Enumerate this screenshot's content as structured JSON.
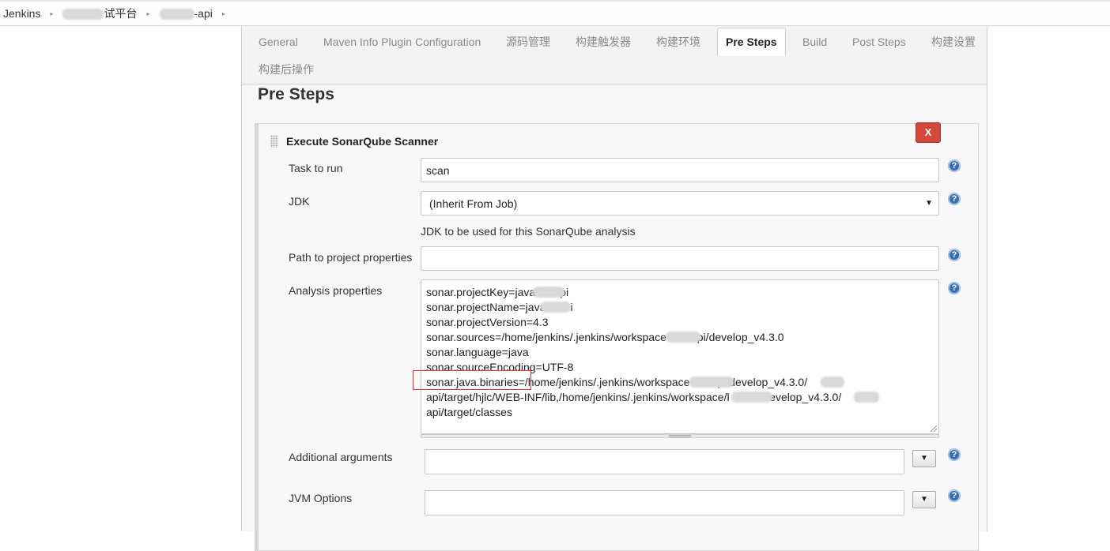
{
  "breadcrumb": {
    "items": [
      {
        "label": "Jenkins"
      },
      {
        "label": "试平台"
      },
      {
        "label": "-api"
      }
    ],
    "separator": "▸"
  },
  "tabs": [
    {
      "label": "General"
    },
    {
      "label": "Maven Info Plugin Configuration"
    },
    {
      "label": "源码管理"
    },
    {
      "label": "构建触发器"
    },
    {
      "label": "构建环境"
    },
    {
      "label": "Pre Steps",
      "active": true
    },
    {
      "label": "Build"
    },
    {
      "label": "Post Steps"
    },
    {
      "label": "构建设置"
    },
    {
      "label": "构建后操作"
    }
  ],
  "section": {
    "title": "Pre Steps"
  },
  "step": {
    "title": "Execute SonarQube Scanner",
    "delete_label": "X",
    "fields": {
      "task": {
        "label": "Task to run",
        "value": "scan"
      },
      "jdk": {
        "label": "JDK",
        "value": "(Inherit From Job)",
        "hint": "JDK to be used for this SonarQube analysis"
      },
      "path": {
        "label": "Path to project properties",
        "value": ""
      },
      "analysis": {
        "label": "Analysis properties",
        "lines": [
          "sonar.projectKey=java        pi",
          "sonar.projectName=java        i",
          "sonar.projectVersion=4.3",
          "sonar.sources=/home/jenkins/.jenkins/workspace        api/develop_v4.3.0",
          "sonar.language=java",
          "sonar.sourceEncoding=UTF-8",
          "sonar.java.binaries=/home/jenkins/.jenkins/workspace         pi/develop_v4.3.0/",
          "api/target/hjlc/WEB-INF/lib,/home/jenkins/.jenkins/workspace/l          /develop_v4.3.0/",
          "api/target/classes"
        ]
      },
      "additional": {
        "label": "Additional arguments",
        "value": ""
      },
      "jvm": {
        "label": "JVM Options",
        "value": ""
      }
    },
    "help_label": "?",
    "expand_label": "▼",
    "select_arrow": "▼"
  },
  "colors": {
    "delete": "#d24939",
    "help": "#3a6fb0",
    "highlight": "#e03030"
  }
}
